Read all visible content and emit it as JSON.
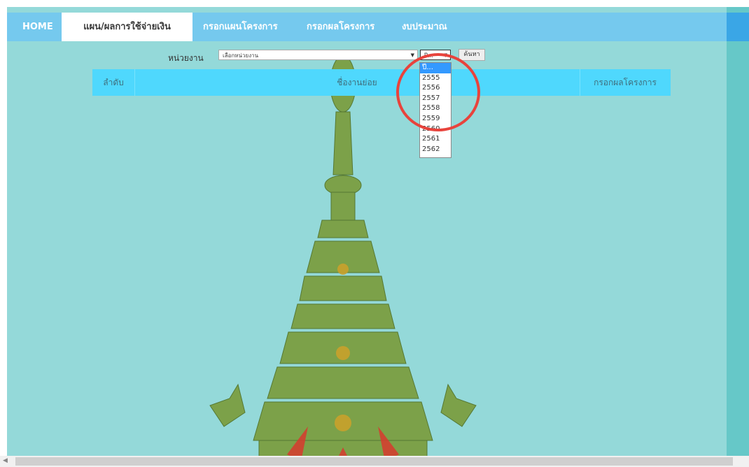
{
  "nav": {
    "items": [
      {
        "label": "HOME"
      },
      {
        "label": "แผน/ผลการใช้จ่ายเงิน"
      },
      {
        "label": "กรอกแผนโครงการ"
      },
      {
        "label": "กรอกผลโครงการ"
      },
      {
        "label": "งบประมาณ"
      }
    ],
    "active_index": 1
  },
  "filter": {
    "label": "หน่วยงาน",
    "department_select": {
      "value": "เลือกหน่วยงาน"
    },
    "year_select": {
      "value": "ปี..."
    },
    "search_button": "ค้นหา"
  },
  "table": {
    "columns": [
      "ลำดับ",
      "ชื่องานย่อย",
      "กรอกผลโครงการ"
    ]
  },
  "year_dropdown": {
    "options": [
      "ปี...",
      "2555",
      "2556",
      "2557",
      "2558",
      "2559",
      "2560",
      "2561",
      "2562"
    ],
    "selected_index": 0
  },
  "colors": {
    "background": "#94d9d9",
    "nav": "#75c9ee",
    "table_header": "#4fd8fd",
    "highlight_circle": "#e8433c",
    "emblem": "#7a9b3a"
  },
  "icons": [
    "dropdown-arrow-icon",
    "royal-emblem",
    "scroll-left-icon"
  ]
}
